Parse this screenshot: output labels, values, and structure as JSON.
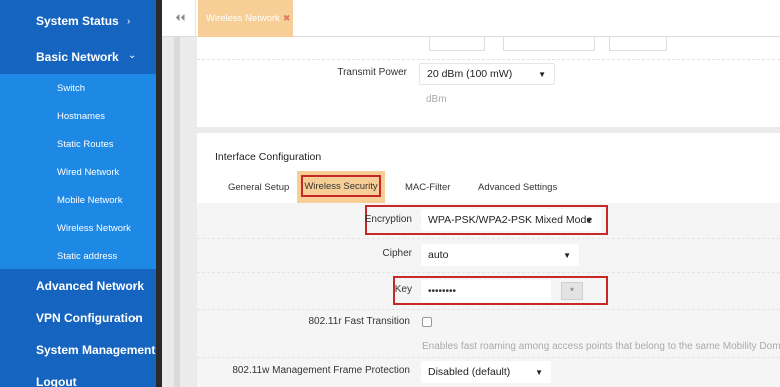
{
  "sidebar": {
    "items": [
      {
        "label": "System Status",
        "chevron": "›"
      },
      {
        "label": "Basic Network",
        "chevron": "⌄"
      },
      {
        "label": "Advanced Network",
        "chevron": "›"
      },
      {
        "label": "VPN Configuration",
        "chevron": "›"
      },
      {
        "label": "System Management",
        "chevron": ""
      },
      {
        "label": "Logout",
        "chevron": ""
      }
    ],
    "subitems": [
      "Switch",
      "Hostnames",
      "Static Routes",
      "Wired Network",
      "Mobile Network",
      "Wireless Network",
      "Static address"
    ]
  },
  "tabs": {
    "nav_glyph": "⏴⏴",
    "active": {
      "label": "Wireless Network",
      "close": "✖"
    }
  },
  "top_panel": {
    "transmit_power_label": "Transmit Power",
    "transmit_power_value": "20 dBm (100 mW)",
    "transmit_power_help": "dBm"
  },
  "interface": {
    "title": "Interface Configuration",
    "subtabs": [
      "General Setup",
      "Wireless Security",
      "MAC-Filter",
      "Advanced Settings"
    ],
    "encryption_label": "Encryption",
    "encryption_value": "WPA-PSK/WPA2-PSK Mixed Mode",
    "cipher_label": "Cipher",
    "cipher_value": "auto",
    "key_label": "Key",
    "key_value": "••••••••",
    "reveal_glyph": "*",
    "ft_label": "802.11r Fast Transition",
    "ft_help": "Enables fast roaming among access points that belong to the same Mobility Domain",
    "mfp_label": "802.11w Management Frame Protection",
    "mfp_value": "Disabled (default)"
  },
  "colors": {
    "sidebar": "#1565c0",
    "subitem": "#1e88e5",
    "active_tab": "#f7cf96",
    "highlight": "#c62828"
  }
}
